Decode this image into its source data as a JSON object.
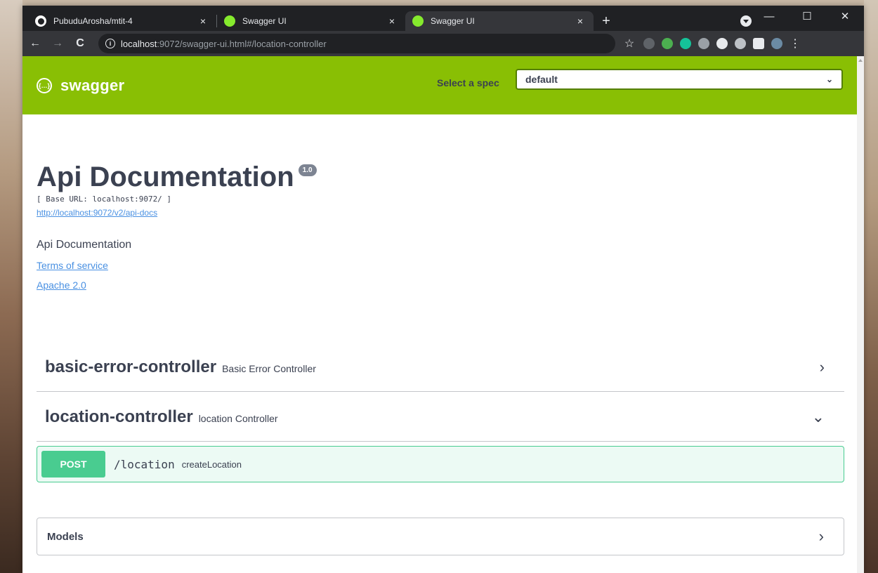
{
  "browser": {
    "tabs": [
      {
        "title": "PubuduArosha/mtit-4",
        "favicon": "github-icon",
        "active": false
      },
      {
        "title": "Swagger UI",
        "favicon": "swagger-icon",
        "active": false
      },
      {
        "title": "Swagger UI",
        "favicon": "swagger-icon",
        "active": true
      }
    ],
    "close_glyph": "×",
    "new_tab_glyph": "+",
    "url_host": "localhost",
    "url_rest": ":9072/swagger-ui.html#/location-controller",
    "info_glyph": "i",
    "star_glyph": "☆",
    "menu_glyph": "⋮",
    "back_glyph": "←",
    "forward_glyph": "→",
    "reload_glyph": "C",
    "win_min": "—",
    "win_max": "☐",
    "win_close": "✕"
  },
  "swagger": {
    "logo_text": "swagger",
    "logo_mark": "{…}",
    "spec_label": "Select a spec",
    "spec_value": "default",
    "chevron": "⌄",
    "title": "Api Documentation",
    "version": "1.0",
    "base_url": "[ Base URL: localhost:9072/ ]",
    "api_docs_link": "http://localhost:9072/v2/api-docs",
    "description": "Api Documentation",
    "terms": "Terms of service",
    "license": "Apache 2.0",
    "controllers": [
      {
        "name": "basic-error-controller",
        "desc": "Basic Error Controller",
        "arrow": "›"
      },
      {
        "name": "location-controller",
        "desc": "location Controller",
        "arrow": "⌄"
      }
    ],
    "operation": {
      "method": "POST",
      "path": "/location",
      "summary": "createLocation"
    },
    "models_label": "Models",
    "models_arrow": "›"
  },
  "colors": {
    "swagger_green": "#89bf04",
    "post_green": "#49cc90",
    "link_blue": "#4990e2",
    "chrome_dark": "#202124"
  }
}
